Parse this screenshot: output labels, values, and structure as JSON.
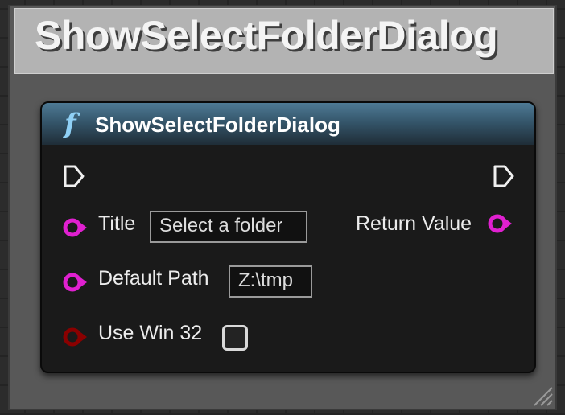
{
  "comment": {
    "title": "ShowSelectFolderDialog",
    "color": "#585858"
  },
  "node": {
    "icon": "function-icon",
    "icon_glyph": "f",
    "title": "ShowSelectFolderDialog",
    "header_color": "#4e7a95",
    "inputs": [
      {
        "label": "Title",
        "value": "Select a folder",
        "pin_color": "#e020d0"
      },
      {
        "label": "Default Path",
        "value": "Z:\\tmp",
        "pin_color": "#e020d0"
      },
      {
        "label": "Use Win 32",
        "checked": false,
        "pin_color": "#8a0000"
      }
    ],
    "outputs": [
      {
        "label": "Return Value",
        "pin_color": "#e020d0"
      }
    ]
  }
}
